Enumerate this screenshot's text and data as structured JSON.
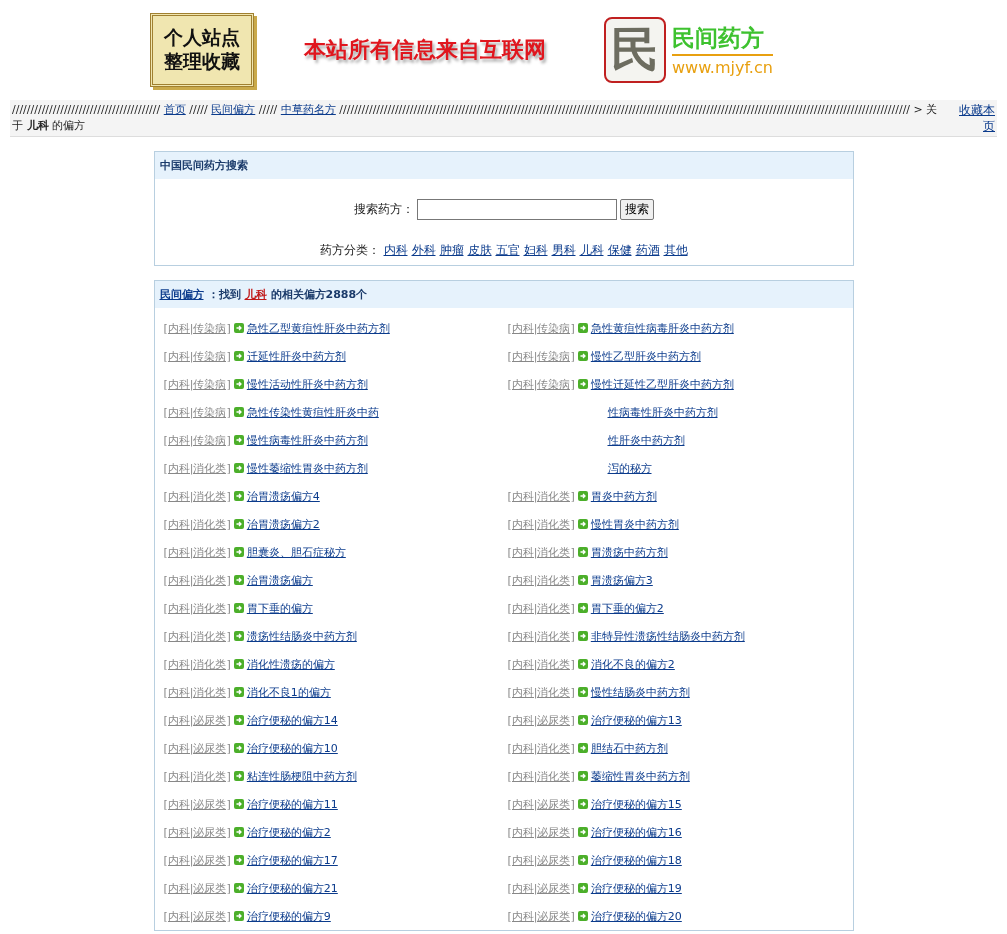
{
  "header": {
    "site_badge": [
      "个人站点",
      "整理收藏"
    ],
    "notice": "本站所有信息来自互联网",
    "logo_char": "民",
    "logo_title": "民间药方",
    "logo_url": "www.mjyf.cn"
  },
  "breadcrumb": {
    "parts": [
      {
        "kind": "text",
        "text": "////////////////////////////////////////"
      },
      {
        "kind": "link",
        "text": "首页"
      },
      {
        "kind": "text",
        "text": "/////"
      },
      {
        "kind": "link",
        "text": "民间偏方"
      },
      {
        "kind": "text",
        "text": "/////"
      },
      {
        "kind": "link",
        "text": "中草药名方"
      },
      {
        "kind": "text",
        "text": "////////////////////////////////////////////////////////////////////////////////////////////////////////////////////////////////////////////////////////// > 关于 **儿科** 的偏方"
      }
    ],
    "bookmark_link": "收藏本页"
  },
  "search_panel": {
    "title": "中国民间药方搜索",
    "label": "搜索药方：",
    "button": "搜索",
    "category_label": "药方分类：",
    "categories": [
      "内科",
      "外科",
      "肿瘤",
      "皮肤",
      "五官",
      "妇科",
      "男科",
      "儿科",
      "保健",
      "药酒",
      "其他"
    ]
  },
  "results": {
    "site_link": "民间偏方",
    "found_text": "：找到",
    "category": "儿科",
    "count_text": "的相关偏方2888个",
    "items": [
      {
        "tag": "[内科|传染病]",
        "title": "急性乙型黄疸性肝炎中药方剂"
      },
      {
        "tag": "[内科|传染病]",
        "title": "急性黄疸性病毒肝炎中药方剂"
      },
      {
        "tag": "[内科|传染病]",
        "title": "迁延性肝炎中药方剂"
      },
      {
        "tag": "[内科|传染病]",
        "title": "慢性乙型肝炎中药方剂"
      },
      {
        "tag": "[内科|传染病]",
        "title": "慢性活动性肝炎中药方剂"
      },
      {
        "tag": "[内科|传染病]",
        "title": "慢性迁延性乙型肝炎中药方剂"
      },
      {
        "tag": "[内科|传染病]",
        "title": "急性传染性黄疸性肝炎中药"
      },
      {
        "title": "性病毒性肝炎中药方剂"
      },
      {
        "tag": "[内科|传染病]",
        "title": "慢性病毒性肝炎中药方剂"
      },
      {
        "title": "性肝炎中药方剂"
      },
      {
        "tag": "[内科|消化类]",
        "title": "慢性萎缩性胃炎中药方剂"
      },
      {
        "title": "泻的秘方"
      },
      {
        "tag": "[内科|消化类]",
        "title": "治胃溃疡偏方4"
      },
      {
        "tag": "[内科|消化类]",
        "title": "胃炎中药方剂"
      },
      {
        "tag": "[内科|消化类]",
        "title": "治胃溃疡偏方2"
      },
      {
        "tag": "[内科|消化类]",
        "title": "慢性胃炎中药方剂"
      },
      {
        "tag": "[内科|消化类]",
        "title": "胆囊炎、胆石症秘方"
      },
      {
        "tag": "[内科|消化类]",
        "title": "胃溃疡中药方剂"
      },
      {
        "tag": "[内科|消化类]",
        "title": "治胃溃疡偏方"
      },
      {
        "tag": "[内科|消化类]",
        "title": "胃溃疡偏方3"
      },
      {
        "tag": "[内科|消化类]",
        "title": "胃下垂的偏方"
      },
      {
        "tag": "[内科|消化类]",
        "title": "胃下垂的偏方2"
      },
      {
        "tag": "[内科|消化类]",
        "title": "溃疡性结肠炎中药方剂"
      },
      {
        "tag": "[内科|消化类]",
        "title": "非特异性溃疡性结肠炎中药方剂"
      },
      {
        "tag": "[内科|消化类]",
        "title": "消化性溃疡的偏方"
      },
      {
        "tag": "[内科|消化类]",
        "title": "消化不良的偏方2"
      },
      {
        "tag": "[内科|消化类]",
        "title": "消化不良1的偏方"
      },
      {
        "tag": "[内科|消化类]",
        "title": "慢性结肠炎中药方剂"
      },
      {
        "tag": "[内科|泌尿类]",
        "title": "治疗便秘的偏方14"
      },
      {
        "tag": "[内科|泌尿类]",
        "title": "治疗便秘的偏方13"
      },
      {
        "tag": "[内科|泌尿类]",
        "title": "治疗便秘的偏方10"
      },
      {
        "tag": "[内科|消化类]",
        "title": "胆结石中药方剂"
      },
      {
        "tag": "[内科|消化类]",
        "title": "粘连性肠梗阻中药方剂"
      },
      {
        "tag": "[内科|消化类]",
        "title": "萎缩性胃炎中药方剂"
      },
      {
        "tag": "[内科|泌尿类]",
        "title": "治疗便秘的偏方11"
      },
      {
        "tag": "[内科|泌尿类]",
        "title": "治疗便秘的偏方15"
      },
      {
        "tag": "[内科|泌尿类]",
        "title": "治疗便秘的偏方2"
      },
      {
        "tag": "[内科|泌尿类]",
        "title": "治疗便秘的偏方16"
      },
      {
        "tag": "[内科|泌尿类]",
        "title": "治疗便秘的偏方17"
      },
      {
        "tag": "[内科|泌尿类]",
        "title": "治疗便秘的偏方18"
      },
      {
        "tag": "[内科|泌尿类]",
        "title": "治疗便秘的偏方21"
      },
      {
        "tag": "[内科|泌尿类]",
        "title": "治疗便秘的偏方19"
      },
      {
        "tag": "[内科|泌尿类]",
        "title": "治疗便秘的偏方9"
      },
      {
        "tag": "[内科|泌尿类]",
        "title": "治疗便秘的偏方20"
      }
    ]
  }
}
